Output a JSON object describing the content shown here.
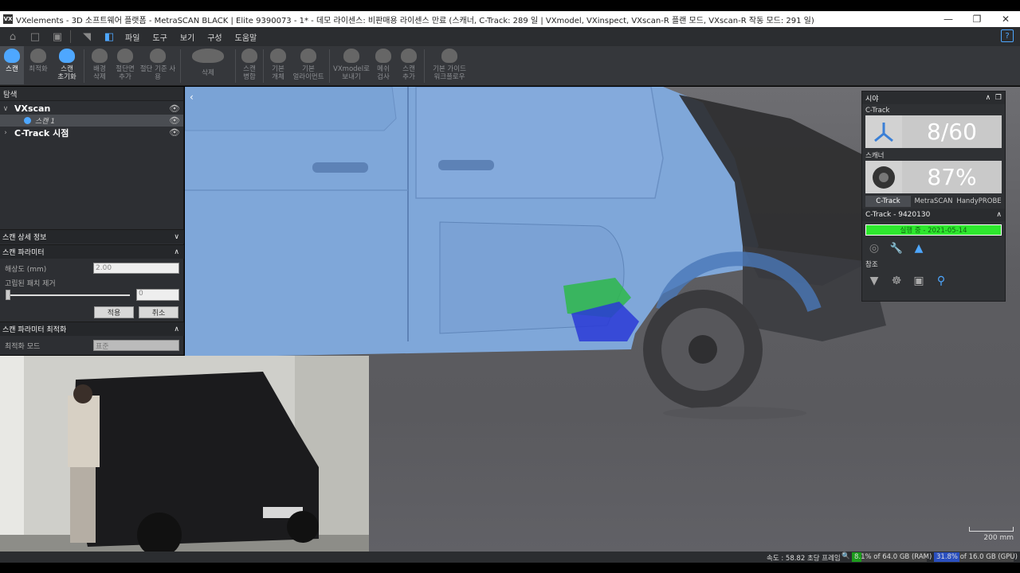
{
  "window": {
    "app_icon": "VX",
    "title": "VXelements - 3D 소프트웨어 플랫폼 - MetraSCAN BLACK | Elite 9390073 - 1* - 데모 라이센스: 비판매용 라이센스 만료 (스캐너, C-Track: 289 일 | VXmodel, VXinspect, VXscan-R 플랜 모드, VXscan-R 작동 모드: 291 일)"
  },
  "menubar": {
    "items": [
      "파일",
      "도구",
      "보기",
      "구성",
      "도움말"
    ],
    "help": "?"
  },
  "ribbon": {
    "buttons": [
      {
        "label": "스캔"
      },
      {
        "label": "최적화"
      },
      {
        "label": "스캔\n초기화"
      },
      {
        "label": "배경\n삭제"
      },
      {
        "label": "절단면\n추가"
      },
      {
        "label": "절단 기준 사\n용"
      },
      {
        "label": "삭제"
      },
      {
        "label": "스캔\n병합"
      },
      {
        "label": "기본\n개체"
      },
      {
        "label": "기본\n얼라이먼트"
      },
      {
        "label": "VXmodel로\n보내기"
      },
      {
        "label": "메쉬\n검사"
      },
      {
        "label": "스캔\n추가"
      },
      {
        "label": "기본 가이드\n워크플로우"
      }
    ]
  },
  "explorer": {
    "header": "탐색",
    "root": "VXscan",
    "child": "스캔 1",
    "ctrack": "C-Track 시점"
  },
  "scan_details": {
    "header": "스캔 상세 정보"
  },
  "scan_params": {
    "header": "스캔 파라미터",
    "resolution_label": "해상도 (mm)",
    "resolution_value": "2.00",
    "isolated_label": "고립된 패치 제거",
    "isolated_value": "0",
    "apply": "적용",
    "cancel": "취소"
  },
  "scan_opt": {
    "header": "스캔 파라미터 최적화",
    "mode_label": "최적화 모드",
    "mode_value": "표준"
  },
  "vision_panel": {
    "header": "시야",
    "ctrack_label": "C-Track",
    "ctrack_value": "8/60",
    "scanner_label": "스캐너",
    "scanner_value": "87%",
    "tabs": [
      "C-Track",
      "MetraSCAN",
      "HandyPROBE"
    ],
    "device_header": "C-Track - 9420130",
    "status": "실행 중 - 2021-05-14",
    "ref_label": "참조"
  },
  "statusbar": {
    "fps": "속도 : 58.82 초당 프레임",
    "ram": "8.1% of 64.0 GB (RAM)",
    "ram_fraction": 0.127,
    "gpu": "31.8% of 16.0 GB (GPU)",
    "gpu_fraction": 0.318
  },
  "scale": {
    "label": "200 mm"
  },
  "colors": {
    "accent": "#4ea7ff",
    "status_green": "#2ee82e",
    "scan_blue": "#7ea6d6"
  }
}
